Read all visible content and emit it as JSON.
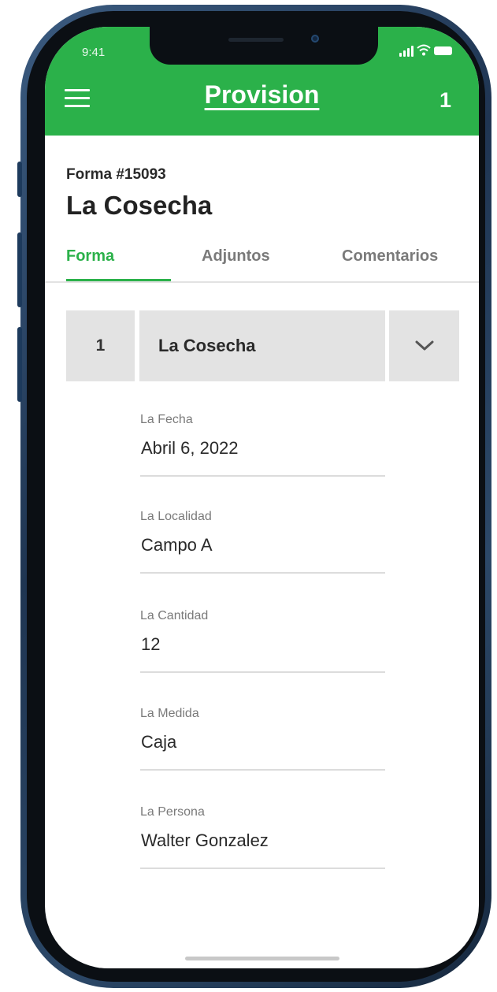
{
  "status_bar": {
    "time": "9:41"
  },
  "header": {
    "title": "Provision",
    "count": "1"
  },
  "form": {
    "number": "Forma #15093",
    "title": "La Cosecha"
  },
  "tabs": [
    {
      "label": "Forma",
      "active": true
    },
    {
      "label": "Adjuntos",
      "active": false
    },
    {
      "label": "Comentarios",
      "active": false
    }
  ],
  "section": {
    "index": "1",
    "name": "La Cosecha",
    "toggle_icon": "chevron-down-icon"
  },
  "fields": [
    {
      "label": "La Fecha",
      "value": "Abril 6, 2022"
    },
    {
      "label": "La Localidad",
      "value": "Campo A"
    },
    {
      "label": "La Cantidad",
      "value": "12"
    },
    {
      "label": "La Medida",
      "value": "Caja"
    },
    {
      "label": "La Persona",
      "value": "Walter Gonzalez"
    }
  ],
  "colors": {
    "brand_green": "#2bb14a",
    "frame_blue": "#1f3552",
    "section_gray": "#e3e3e3"
  }
}
